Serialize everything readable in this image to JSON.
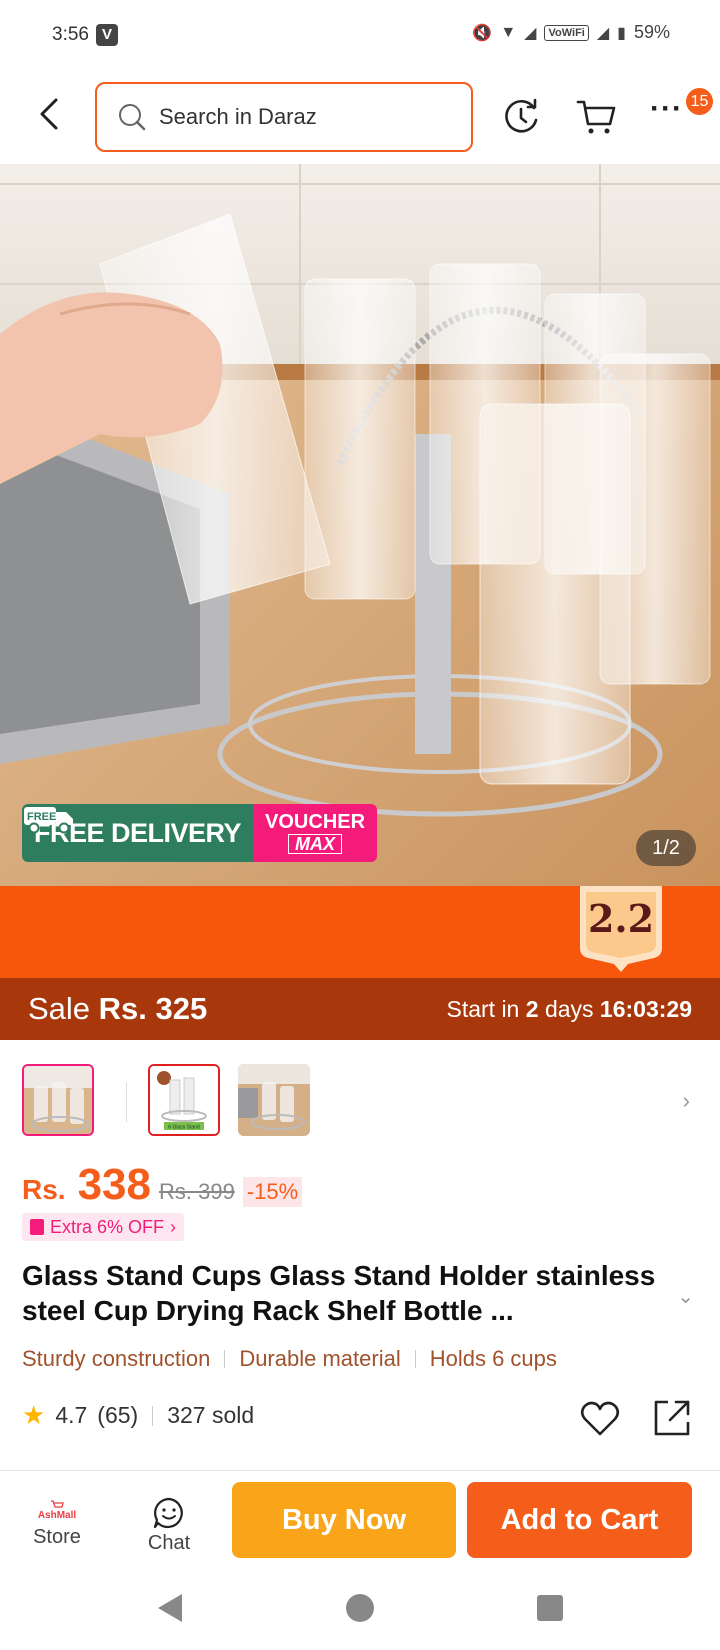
{
  "status_bar": {
    "time": "3:56",
    "app_badge": "V",
    "wifi_label": "VoWiFi",
    "battery": "59%"
  },
  "header": {
    "search_placeholder": "Search in Daraz",
    "notification_count": "15"
  },
  "gallery": {
    "promo_free_delivery": "FREE DELIVERY",
    "truck_label": "FREE",
    "voucher_top": "VOUCHER",
    "voucher_max": "MAX",
    "counter": "1/2"
  },
  "campaign": {
    "badge": "2.2"
  },
  "sale": {
    "label": "Sale",
    "price": "Rs. 325",
    "start_prefix": "Start in",
    "days": "2",
    "days_label": "days",
    "countdown": "16:03:29"
  },
  "thumbnails": {
    "thumb2_label": "6 Glass Stand"
  },
  "pricing": {
    "currency": "Rs.",
    "current": "338",
    "original": "Rs. 399",
    "discount": "-15%",
    "extra_offer": "Extra 6% OFF"
  },
  "product": {
    "title": "Glass Stand Cups Glass Stand Holder stainless steel Cup Drying Rack Shelf Bottle ...",
    "features": [
      "Sturdy construction",
      "Durable material",
      "Holds 6 cups"
    ],
    "rating": "4.7",
    "review_count": "(65)",
    "sold": "327 sold"
  },
  "action_bar": {
    "store_logo": "AshMall",
    "store_label": "Store",
    "chat_label": "Chat",
    "buy_now": "Buy Now",
    "add_to_cart": "Add to Cart"
  },
  "colors": {
    "brand_orange": "#f55d1b",
    "buy_now_yellow": "#faa41a",
    "sale_bar": "#a8380c",
    "promo_green": "#2e7d5f",
    "voucher_pink": "#f51b7a"
  }
}
